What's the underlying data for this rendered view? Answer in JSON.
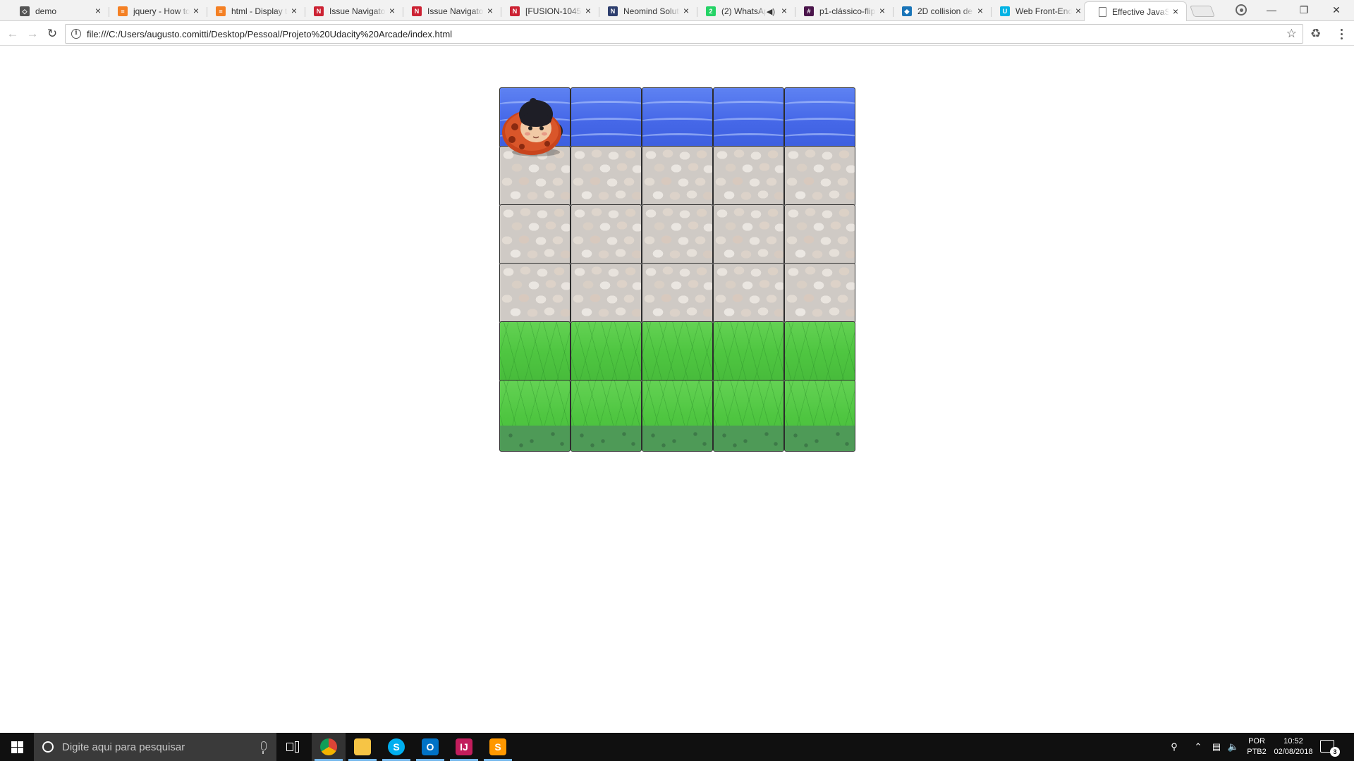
{
  "browser": {
    "tabs": [
      {
        "title": "demo",
        "favicon": "codepen-icon",
        "color": "#555555"
      },
      {
        "title": "jquery - How to",
        "favicon": "stackoverflow-icon",
        "color": "#f48024"
      },
      {
        "title": "html - Display t",
        "favicon": "stackoverflow-icon",
        "color": "#f48024"
      },
      {
        "title": "Issue Navigator",
        "favicon": "jira-icon",
        "color": "#cc2233"
      },
      {
        "title": "Issue Navigator",
        "favicon": "jira-icon",
        "color": "#cc2233"
      },
      {
        "title": "[FUSION-1045]",
        "favicon": "jira-icon",
        "color": "#cc2233"
      },
      {
        "title": "Neomind Soluti",
        "favicon": "neomind-icon",
        "color": "#2d3e6e"
      },
      {
        "title": "(2) WhatsApp",
        "favicon": "whatsapp-icon",
        "color": "#25d366",
        "audio": true
      },
      {
        "title": "p1-clássico-flip",
        "favicon": "slack-icon",
        "color": "#4a154b"
      },
      {
        "title": "2D collision de",
        "favicon": "mdn-icon",
        "color": "#1a75b8"
      },
      {
        "title": "Web Front-End",
        "favicon": "udacity-icon",
        "color": "#02b3e4"
      },
      {
        "title": "Effective JavaS",
        "favicon": "page-icon",
        "color": "#ffffff",
        "active": true
      }
    ],
    "url": "file:///C:/Users/augusto.comitti/Desktop/Pessoal/Projeto%20Udacity%20Arcade/index.html"
  },
  "game": {
    "board_columns": 5,
    "rows": [
      "water",
      "stone",
      "stone",
      "stone",
      "grass",
      "grass"
    ],
    "player": {
      "row": 0,
      "column": 0,
      "sprite": "ladybug-character"
    }
  },
  "taskbar": {
    "search_placeholder": "Digite aqui para pesquisar",
    "apps": [
      {
        "name": "chrome",
        "running": true,
        "active": true
      },
      {
        "name": "file-explorer",
        "running": true
      },
      {
        "name": "skype",
        "running": true
      },
      {
        "name": "outlook",
        "running": true
      },
      {
        "name": "intellij",
        "running": true
      },
      {
        "name": "sublime-text",
        "running": true
      }
    ],
    "language_top": "POR",
    "language_bottom": "PTB2",
    "time": "10:52",
    "date": "02/08/2018",
    "notification_count": "3"
  }
}
